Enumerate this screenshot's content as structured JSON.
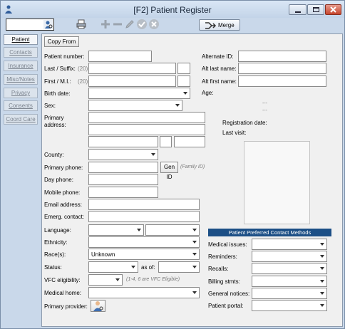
{
  "window": {
    "title": "[F2] Patient Register"
  },
  "toolbar": {
    "merge_label": "Merge"
  },
  "sidebar": {
    "tabs": [
      {
        "label": "Patient"
      },
      {
        "label": "Contacts"
      },
      {
        "label": "Insurance"
      },
      {
        "label": "Misc/Notes"
      },
      {
        "label": "Privacy"
      },
      {
        "label": "Consents"
      },
      {
        "label": "Coord Care"
      }
    ]
  },
  "form": {
    "copy_from": "Copy From",
    "patient_number": "Patient number:",
    "last_suffix": "Last / Suffix:",
    "last_hint": "(20)",
    "first_mi": "First / M.I.:",
    "first_hint": "(20)",
    "birth_date": "Birth date:",
    "sex": "Sex:",
    "primary_address": "Primary address:",
    "county": "County:",
    "primary_phone": "Primary phone:",
    "gen_id": "Gen ID",
    "family_id": "(Family ID)",
    "day_phone": "Day phone:",
    "mobile_phone": "Mobile phone:",
    "email": "Email address:",
    "emerg_contact": "Emerg. contact:",
    "language": "Language:",
    "ethnicity": "Ethnicity:",
    "race": "Race(s):",
    "race_value": "Unknown",
    "status": "Status:",
    "as_of": "as of:",
    "vfc": "VFC eligibility:",
    "vfc_hint": "(1-4, 6 are VFC Eligible)",
    "medical_home": "Medical home:",
    "primary_provider": "Primary provider:"
  },
  "right": {
    "alternate_id": "Alternate ID:",
    "alt_last": "Alt last name:",
    "alt_first": "Alt first name:",
    "age": "Age:",
    "dash1": "---",
    "dash2": "---",
    "registration_date": "Registration date:",
    "last_visit": "Last visit:"
  },
  "contact_methods": {
    "header": "Patient Preferred Contact Methods",
    "items": [
      {
        "label": "Medical issues:"
      },
      {
        "label": "Reminders:"
      },
      {
        "label": "Recalls:"
      },
      {
        "label": "Billing stmts:"
      },
      {
        "label": "General notices:"
      },
      {
        "label": "Patient portal:"
      }
    ]
  }
}
